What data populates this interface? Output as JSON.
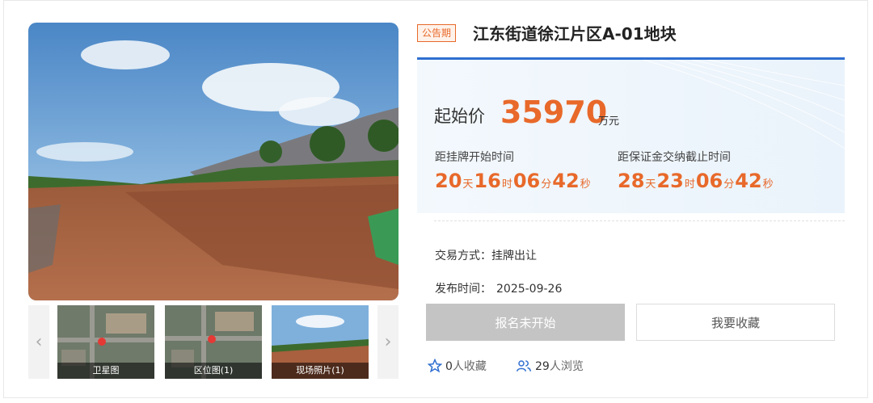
{
  "status_tag": "公告期",
  "title": "江东街道徐江片区A-01地块",
  "price": {
    "label": "起始价",
    "value": "35970",
    "unit": "万元"
  },
  "countdowns": [
    {
      "label": "距挂牌开始时间",
      "days": "20",
      "hours": "16",
      "minutes": "06",
      "seconds": "42"
    },
    {
      "label": "距保证金交纳截止时间",
      "days": "28",
      "hours": "23",
      "minutes": "06",
      "seconds": "42"
    }
  ],
  "units": {
    "day": "天",
    "hour": "时",
    "minute": "分",
    "second": "秒"
  },
  "info": {
    "trade_label": "交易方式：",
    "trade_value": "挂牌出让",
    "publish_label": "发布时间：",
    "publish_value": "2025-09-26"
  },
  "thumbnails": [
    {
      "caption": "卫星图"
    },
    {
      "caption": "区位图(1)"
    },
    {
      "caption": "现场照片(1)"
    }
  ],
  "buttons": {
    "signup": "报名未开始",
    "favorite": "我要收藏"
  },
  "stats": {
    "favorites_count": "0",
    "favorites_label": "人收藏",
    "views_count": "29",
    "views_label": "人浏览"
  },
  "colors": {
    "accent": "#e8692a",
    "blue": "#2f6fd0"
  }
}
